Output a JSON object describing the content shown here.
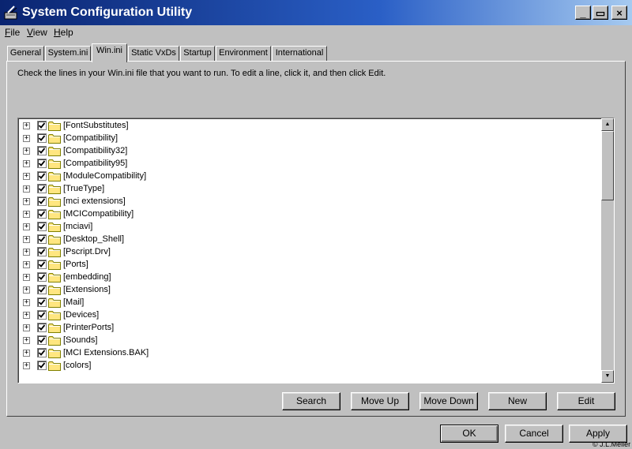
{
  "window": {
    "title": "System Configuration Utility",
    "icon": "system-config-icon",
    "controls": {
      "minimize": "_",
      "maximize": "▭",
      "close": "×"
    }
  },
  "menu": [
    {
      "label": "File"
    },
    {
      "label": "View"
    },
    {
      "label": "Help"
    }
  ],
  "tabs": [
    {
      "label": "General"
    },
    {
      "label": "System.ini"
    },
    {
      "label": "Win.ini",
      "active": true
    },
    {
      "label": "Static VxDs"
    },
    {
      "label": "Startup"
    },
    {
      "label": "Environment"
    },
    {
      "label": "International"
    }
  ],
  "instruction": "Check the lines in your Win.ini file that you want to run. To edit a line, click it, and then click Edit.",
  "list": {
    "items": [
      {
        "label": "[FontSubstitutes]",
        "checked": true
      },
      {
        "label": "[Compatibility]",
        "checked": true
      },
      {
        "label": "[Compatibility32]",
        "checked": true
      },
      {
        "label": "[Compatibility95]",
        "checked": true
      },
      {
        "label": "[ModuleCompatibility]",
        "checked": true
      },
      {
        "label": "[TrueType]",
        "checked": true
      },
      {
        "label": "[mci extensions]",
        "checked": true
      },
      {
        "label": "[MCICompatibility]",
        "checked": true
      },
      {
        "label": "[mciavi]",
        "checked": true
      },
      {
        "label": "[Desktop_Shell]",
        "checked": true
      },
      {
        "label": "[Pscript.Drv]",
        "checked": true
      },
      {
        "label": "[Ports]",
        "checked": true
      },
      {
        "label": "[embedding]",
        "checked": true
      },
      {
        "label": "[Extensions]",
        "checked": true
      },
      {
        "label": "[Mail]",
        "checked": true
      },
      {
        "label": "[Devices]",
        "checked": true
      },
      {
        "label": "[PrinterPorts]",
        "checked": true
      },
      {
        "label": "[Sounds]",
        "checked": true
      },
      {
        "label": "[MCI Extensions.BAK]",
        "checked": true
      },
      {
        "label": "[colors]",
        "checked": true
      }
    ]
  },
  "buttons": {
    "search": "Search",
    "move_up": "Move Up",
    "move_down": "Move Down",
    "new": "New",
    "edit": "Edit",
    "ok": "OK",
    "cancel": "Cancel",
    "apply": "Apply"
  },
  "copyright": "© J.L.Meller",
  "colors": {
    "titlebar_start": "#0a2470",
    "titlebar_end": "#a6caf0",
    "window_bg": "#c0c0c0",
    "folder": "#ffe680"
  }
}
